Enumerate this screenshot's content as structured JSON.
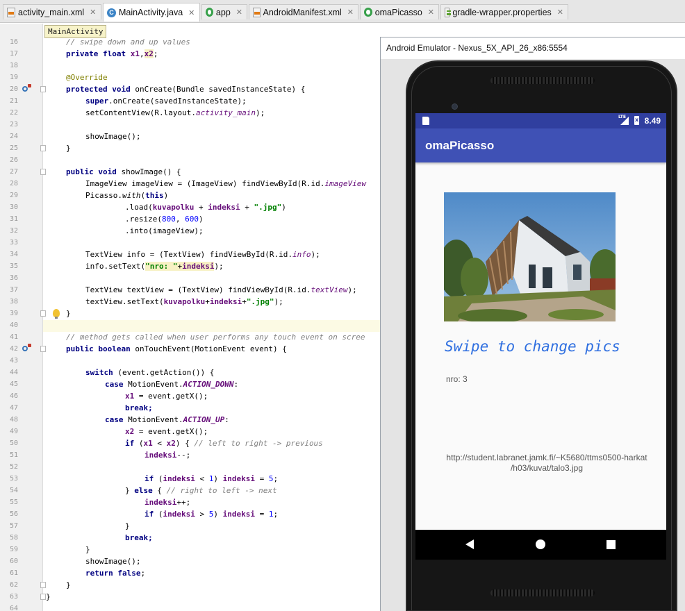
{
  "tabs": [
    {
      "label": "activity_main.xml",
      "icon": "xml-file-icon"
    },
    {
      "label": "MainActivity.java",
      "icon": "java-class-icon",
      "active": true
    },
    {
      "label": "app",
      "icon": "module-icon"
    },
    {
      "label": "AndroidManifest.xml",
      "icon": "manifest-icon"
    },
    {
      "label": "omaPicasso",
      "icon": "module-icon"
    },
    {
      "label": "gradle-wrapper.properties",
      "icon": "properties-file-icon"
    }
  ],
  "breadcrumb": "MainActivity",
  "editor": {
    "line_numbers": [
      "16",
      "17",
      "18",
      "19",
      "20",
      "21",
      "22",
      "23",
      "24",
      "25",
      "26",
      "27",
      "28",
      "29",
      "30",
      "31",
      "32",
      "33",
      "34",
      "35",
      "36",
      "37",
      "38",
      "39",
      "40",
      "41",
      "42",
      "43",
      "44",
      "45",
      "46",
      "47",
      "48",
      "49",
      "50",
      "51",
      "52",
      "53",
      "54",
      "55",
      "56",
      "57",
      "58",
      "59",
      "60",
      "61",
      "62",
      "63",
      "64"
    ],
    "code": {
      "l16": "// swipe down and up values",
      "l17a": "private float ",
      "l17b": "x1",
      "l17c": ",",
      "l17d": "x2",
      "l17e": ";",
      "l19": "@Override",
      "l20a": "protected void ",
      "l20b": "onCreate(Bundle savedInstanceState) {",
      "l21a": "super",
      "l21b": ".onCreate(savedInstanceState);",
      "l22a": "setContentView(R.layout.",
      "l22b": "activity_main",
      "l22c": ");",
      "l24": "showImage();",
      "l25": "}",
      "l27a": "public void ",
      "l27b": "showImage() {",
      "l28a": "ImageView imageView = (ImageView) findViewById(R.id.",
      "l28b": "imageView",
      "l29a": "Picasso.",
      "l29b": "with",
      "l29c": "(",
      "l29d": "this",
      "l29e": ")",
      "l30a": ".load(",
      "l30b": "kuvapolku",
      "l30c": " + ",
      "l30d": "indeksi",
      "l30e": " + ",
      "l30f": "\".jpg\"",
      "l30g": ")",
      "l31a": ".resize(",
      "l31b": "800",
      "l31c": ", ",
      "l31d": "600",
      "l31e": ")",
      "l32": ".into(imageView);",
      "l34a": "TextView info = (TextView) findViewById(R.id.",
      "l34b": "info",
      "l34c": ");",
      "l35a": "info.setText(",
      "l35b": "\"nro: \"",
      "l35c": "+",
      "l35d": "indeksi",
      "l35e": ");",
      "l37a": "TextView textView = (TextView) findViewById(R.id.",
      "l37b": "textView",
      "l37c": ");",
      "l38a": "textView.setText(",
      "l38b": "kuvapolku",
      "l38c": "+",
      "l38d": "indeksi",
      "l38e": "+",
      "l38f": "\".jpg\"",
      "l38g": ");",
      "l39": "}",
      "l41": "// method gets called when user performs any touch event on scree",
      "l42a": "public boolean ",
      "l42b": "onTouchEvent(MotionEvent event) {",
      "l44a": "switch ",
      "l44b": "(event.getAction()) {",
      "l45a": "case ",
      "l45b": "MotionEvent.",
      "l45c": "ACTION_DOWN",
      "l45d": ":",
      "l46a": "x1",
      "l46b": " = event.getX();",
      "l47": "break;",
      "l48a": "case ",
      "l48b": "MotionEvent.",
      "l48c": "ACTION_UP",
      "l48d": ":",
      "l49a": "x2",
      "l49b": " = event.getX();",
      "l50a": "if ",
      "l50b": "(",
      "l50c": "x1",
      "l50d": " < ",
      "l50e": "x2",
      "l50f": ") { ",
      "l50g": "// left to right -> previous",
      "l51a": "indeksi",
      "l51b": "--;",
      "l53a": "if ",
      "l53b": "(",
      "l53c": "indeksi",
      "l53d": " < ",
      "l53e": "1",
      "l53f": ") ",
      "l53g": "indeksi",
      "l53h": " = ",
      "l53i": "5",
      "l53j": ";",
      "l54a": "} ",
      "l54b": "else ",
      "l54c": "{ ",
      "l54d": "// right to left -> next",
      "l55a": "indeksi",
      "l55b": "++;",
      "l56a": "if ",
      "l56b": "(",
      "l56c": "indeksi",
      "l56d": " > ",
      "l56e": "5",
      "l56f": ") ",
      "l56g": "indeksi",
      "l56h": " = ",
      "l56i": "1",
      "l56j": ";",
      "l57": "}",
      "l58": "break;",
      "l59": "}",
      "l60": "showImage();",
      "l61a": "return false",
      "l61b": ";",
      "l62": "}",
      "l63": "}"
    }
  },
  "emulator": {
    "window_title": "Android Emulator - Nexus_5X_API_26_x86:5554",
    "status_time": "8.49",
    "app_title": "omaPicasso",
    "swipe_text": "Swipe to change pics",
    "nro_text": "nro: 3",
    "url_line1": "http://student.labranet.jamk.fi/~K5680/ttms0500-harkat",
    "url_line2": "/h03/kuvat/talo3.jpg"
  },
  "colors": {
    "status_bar": "#303f9f",
    "app_bar": "#3f51b5",
    "swipe_text": "#2f6fe0",
    "keyword": "#000080",
    "string": "#008000",
    "field": "#660e7a"
  }
}
